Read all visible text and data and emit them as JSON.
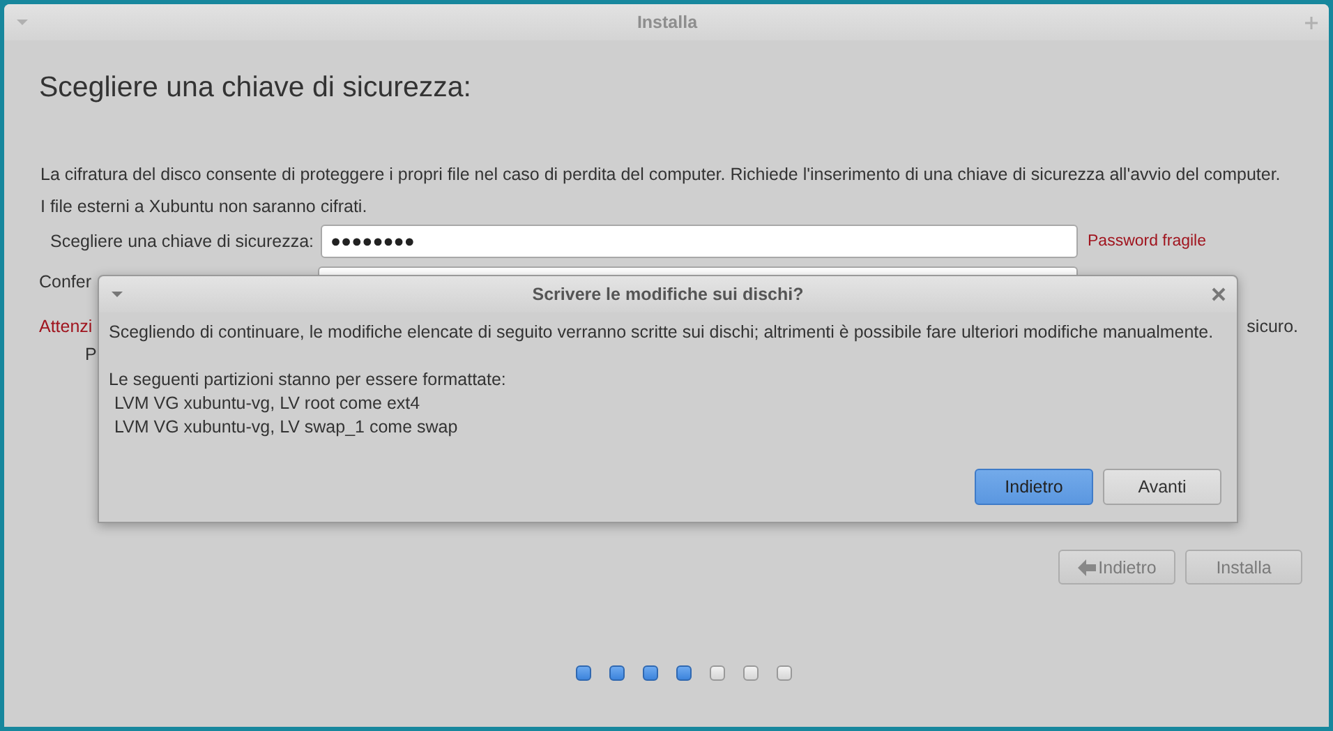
{
  "window": {
    "title": "Installa"
  },
  "page": {
    "heading": "Scegliere una chiave di sicurezza:",
    "description": [
      "La cifratura del disco consente di proteggere i propri file nel caso di perdita del computer. Richiede l'inserimento di una chiave di sicurezza all'avvio del computer.",
      "I file esterni a Xubuntu non saranno cifrati."
    ],
    "key_label": "Scegliere una chiave di sicurezza:",
    "key_value": "●●●●●●●●",
    "strength": "Password fragile",
    "confirm_label": "Confer",
    "warning_start": "Attenzi",
    "warning_end": "sicuro.",
    "note_start": "P"
  },
  "buttons": [
    {
      "label": "Indietro",
      "kind": "back",
      "disabled": true
    },
    {
      "label": "Installa",
      "kind": "plain",
      "disabled": true
    }
  ],
  "progress": [
    {
      "selected": true
    },
    {
      "selected": true
    },
    {
      "selected": true
    },
    {
      "selected": true
    },
    {
      "selected": false
    },
    {
      "selected": false
    },
    {
      "selected": false
    }
  ],
  "dialog": {
    "title": "Scrivere le modifiche sui dischi?",
    "message": "Scegliendo di continuare, le modifiche elencate di seguito verranno scritte sui dischi; altrimenti è possibile fare ulteriori modifiche manualmente.",
    "list_heading": "Le seguenti partizioni stanno per essere formattate:",
    "partitions": [
      "LVM VG xubuntu-vg, LV root come ext4",
      "LVM VG xubuntu-vg, LV swap_1 come swap"
    ],
    "buttons": [
      {
        "label": "Indietro",
        "default": true
      },
      {
        "label": "Avanti",
        "default": false
      }
    ]
  }
}
